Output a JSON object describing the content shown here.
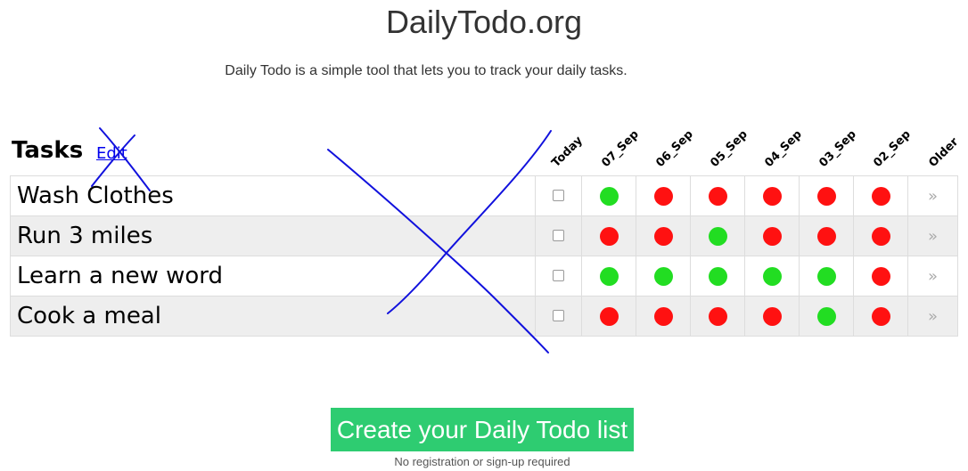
{
  "header": {
    "title": "DailyTodo.org",
    "tagline": "Daily Todo is a simple tool that lets you to track your daily tasks."
  },
  "tasks_section": {
    "heading": "Tasks",
    "edit_label": "Edit"
  },
  "columns": [
    "Today",
    "07_Sep",
    "06_Sep",
    "05_Sep",
    "04_Sep",
    "03_Sep",
    "02_Sep",
    "Older"
  ],
  "more_symbol": "»",
  "colors": {
    "done": "#22dd22",
    "missed": "#ff1111",
    "row_alt": "#eeeeee",
    "button": "#2ecc71",
    "annotation": "#1111dd"
  },
  "tasks": [
    {
      "name": "Wash Clothes",
      "today_checked": false,
      "history": [
        "done",
        "missed",
        "missed",
        "missed",
        "missed",
        "missed"
      ]
    },
    {
      "name": "Run 3 miles",
      "today_checked": false,
      "history": [
        "missed",
        "missed",
        "done",
        "missed",
        "missed",
        "missed"
      ]
    },
    {
      "name": "Learn a new word",
      "today_checked": false,
      "history": [
        "done",
        "done",
        "done",
        "done",
        "done",
        "missed"
      ]
    },
    {
      "name": "Cook a meal",
      "today_checked": false,
      "history": [
        "missed",
        "missed",
        "missed",
        "missed",
        "done",
        "missed"
      ]
    }
  ],
  "cta": {
    "button_label": "Create your Daily Todo list",
    "note": "No registration or sign-up required"
  }
}
